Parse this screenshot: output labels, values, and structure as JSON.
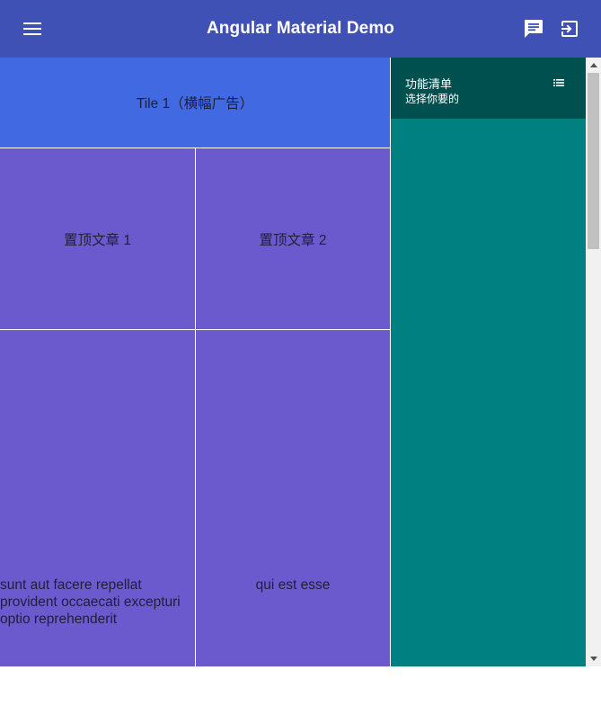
{
  "app_bar": {
    "title": "Angular Material Demo",
    "menu_icon": "menu-icon",
    "message_icon": "message-icon",
    "exit_icon": "exit-to-app-icon",
    "background": "#3f51b5"
  },
  "grid": {
    "banner_tile": {
      "text": "Tile 1（横幅广告）",
      "color": "#4169e1"
    },
    "pinned_tiles": [
      {
        "text": "置顶文章 1"
      },
      {
        "text": "置顶文章 2"
      }
    ],
    "post_tiles": [
      {
        "text": "sunt aut facere repellat provident occaecati excepturi optio reprehenderit"
      },
      {
        "text": "qui est esse"
      }
    ],
    "tile_color": "#6a5acd"
  },
  "sidenav": {
    "title": "功能清单",
    "subtitle": "选择你要的",
    "list_icon": "list-icon",
    "header_color": "#005050",
    "body_color": "#008080"
  },
  "scrollbar": {
    "up_icon": "arrow-up-icon",
    "down_icon": "arrow-down-icon"
  }
}
